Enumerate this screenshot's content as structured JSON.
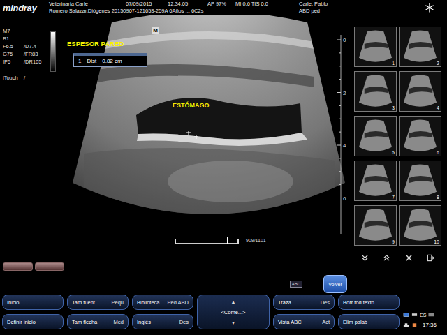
{
  "header": {
    "logo": "mindray",
    "institution": "Veterinaria Carle",
    "date": "07/09/2015",
    "time": "12:34:05",
    "ap": "AP 97%",
    "mi_tis": "MI 0.6 TIS 0.0",
    "operator": "Carle, Pablo",
    "patient": "Romero Salazar,Diógenes 20150907-121653-259A 6Años ... 6C2s",
    "exam": "ABD ped"
  },
  "parameters": [
    {
      "left": "M7",
      "right": ""
    },
    {
      "left": "B1",
      "right": ""
    },
    {
      "left": "F6.5",
      "right": "/D7.4"
    },
    {
      "left": "G75",
      "right": "/FR83"
    },
    {
      "left": "IP5",
      "right": "/DR105"
    },
    {
      "left": "iTouch",
      "right": "/"
    }
  ],
  "image": {
    "title_annotation": "ESPESOR PARED",
    "organ_annotation": "ESTÓMAGO",
    "orientation_mark": "M",
    "measurement": {
      "index": "1",
      "label": "Dist",
      "value": "0.82 cm"
    },
    "depth_scale": [
      "0",
      "2",
      "4",
      "6"
    ],
    "cine": {
      "frame": "909/1101",
      "level": 0.83
    }
  },
  "thumbnails": [
    {
      "number": "1",
      "selected": false
    },
    {
      "number": "2",
      "selected": false
    },
    {
      "number": "3",
      "selected": false
    },
    {
      "number": "4",
      "selected": false
    },
    {
      "number": "5",
      "selected": false
    },
    {
      "number": "6",
      "selected": false
    },
    {
      "number": "7",
      "selected": false
    },
    {
      "number": "8",
      "selected": false
    },
    {
      "number": "9",
      "selected": false
    },
    {
      "number": "10",
      "selected": false
    }
  ],
  "small_button": "ABC",
  "back_button": "Volver",
  "softkeys": [
    [
      {
        "label": "Inicio",
        "value": ""
      },
      {
        "label": "Tam fuent",
        "value": "Pequ"
      },
      {
        "label": "Biblioteca",
        "value": "Ped ABD"
      },
      {
        "label": "Traza",
        "value": "Des"
      },
      {
        "label": "Borr tod texto",
        "value": ""
      }
    ],
    [
      {
        "label": "Definir inicio",
        "value": ""
      },
      {
        "label": "Tam flecha",
        "value": "Med"
      },
      {
        "label": "Inglés",
        "value": "Des"
      },
      {
        "label": "Vista ABC",
        "value": "Act"
      },
      {
        "label": "Elim palab",
        "value": ""
      }
    ]
  ],
  "joystick": {
    "up": "▲",
    "label": "<Come...>",
    "down": "▼"
  },
  "status": {
    "language": "ES",
    "clock": "17:36"
  }
}
